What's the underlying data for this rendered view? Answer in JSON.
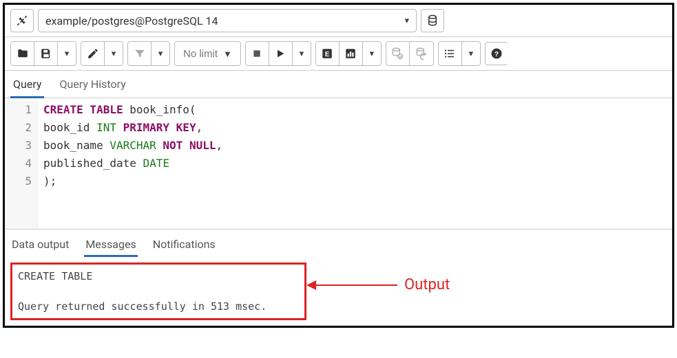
{
  "connection": {
    "label": "example/postgres@PostgreSQL 14"
  },
  "toolbar": {
    "limit_label": "No limit"
  },
  "tabs": {
    "query": "Query",
    "history": "Query History"
  },
  "editor": {
    "lines": [
      "1",
      "2",
      "3",
      "4",
      "5"
    ],
    "sql": {
      "l1_kw": "CREATE TABLE",
      "l1_rest": " book_info(",
      "l2_a": "book_id ",
      "l2_type": "INT",
      "l2_sp": " ",
      "l2_pk": "PRIMARY KEY",
      "l2_end": ",",
      "l3_a": "book_name ",
      "l3_type": "VARCHAR",
      "l3_sp": " ",
      "l3_nn": "NOT NULL",
      "l3_end": ",",
      "l4_a": "published_date ",
      "l4_type": "DATE",
      "l5": ");"
    }
  },
  "output_tabs": {
    "data": "Data output",
    "messages": "Messages",
    "notifications": "Notifications"
  },
  "output": {
    "line1": "CREATE TABLE",
    "line2": "Query returned successfully in 513 msec."
  },
  "annotation": {
    "label": "Output"
  }
}
